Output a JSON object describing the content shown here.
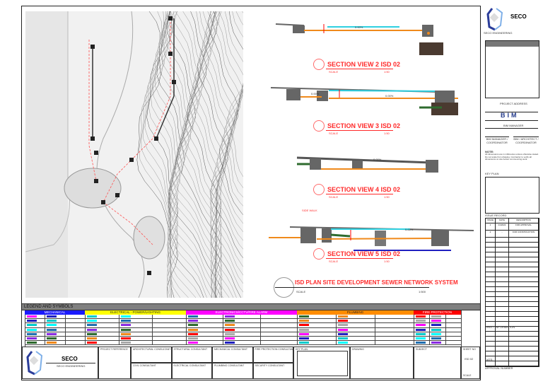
{
  "company": {
    "name": "SECO",
    "tagline": "SECO ENGINEERING"
  },
  "sections": [
    {
      "title": "SECTION VIEW 2 ISD 02",
      "slope": "0.00%",
      "scale_label": "SCALE",
      "scale": "1:50"
    },
    {
      "title": "SECTION VIEW 3 ISD 02",
      "slope": "0.00%",
      "slope_b": "0.00%",
      "scale_label": "SCALE",
      "scale": "1:50"
    },
    {
      "title": "SECTION VIEW 4 ISD 02",
      "slope": "0.00%",
      "scale_label": "SCALE",
      "scale": "1:50"
    },
    {
      "title": "SECTION VIEW 5 ISD 02",
      "slope": "0.00%",
      "annotation": "SIDE WALK",
      "scale_label": "SCALE",
      "scale": "1:50"
    }
  ],
  "drawing_title": {
    "text": "ISD PLAN SITE DEVELOPMENT SEWER NETWORK SYSTEM",
    "scale_label": "SCALE",
    "scale": "1:500"
  },
  "legend": {
    "title": "LEGEND AND SYMBOLS",
    "categories": [
      {
        "label": "MECHANICAL",
        "color": "#1a1aff"
      },
      {
        "label": "ELECTRICAL - POWER/LIGHTING",
        "color": "#ffff00"
      },
      {
        "label": "ELECTRONICS/CCTV/FIRE ALARM",
        "color": "#ff00ff"
      },
      {
        "label": "PLUMBING",
        "color": "#ff8c00"
      },
      {
        "label": "FIRE PROTECTION",
        "color": "#ff0000"
      }
    ]
  },
  "title_block": {
    "fields": [
      "PROJECT REFERENCE",
      "ARCHITECTURAL CONSULTANT",
      "STRUCTURAL CONSULTANT",
      "MECHANICAL CONSULTANT",
      "FIRE PROTECTION CONSULTANT",
      "CIVIL CONSULTANT",
      "ELECTRICAL CONSULTANT",
      "PLUMBING CONSULTANT",
      "SECURITY CONSULTANT",
      "KEY PLAN",
      "DRAWING",
      "SUBJECT",
      "SHEET NO",
      "SCALE"
    ],
    "sheet_no": "ISD 02"
  },
  "right_panel": {
    "project_label": "PROJECT ADDRESS",
    "bim_logo": "BIM",
    "bim_caption": "BIM MANAGER",
    "sig_left": "BIM MANAGER / COORDINATOR",
    "sig_right": "BIM / ARCHITECT / COORDINATOR",
    "notes_label": "NOTE:",
    "notes_text": "All dimensions are in millimetres unless otherwise stated. Do not scale from drawing. Contractor to verify all dimensions on site before commencing work.",
    "key_plan_label": "KEY PLAN",
    "issue_label": "ISSUE RECORD",
    "issue_headers": [
      "ISSUE",
      "DATE",
      "DESCRIPTION"
    ],
    "issues": [
      {
        "no": "1",
        "date": "01/2024",
        "desc": "FOR APPROVAL"
      },
      {
        "no": "2",
        "date": "-",
        "desc": "FOR CONSTRUCTION"
      }
    ],
    "sheet_info_label": "SHEET INFORMATION",
    "date_label": "DATE:",
    "approval_label": "APPROVAL NUMBER"
  },
  "colors": {
    "accent_red": "#ff2a2a",
    "pipe_orange": "#f08a1c",
    "pipe_cyan": "#2fd0e0",
    "pipe_green": "#2e6b2e",
    "pipe_blue": "#2020c0"
  }
}
